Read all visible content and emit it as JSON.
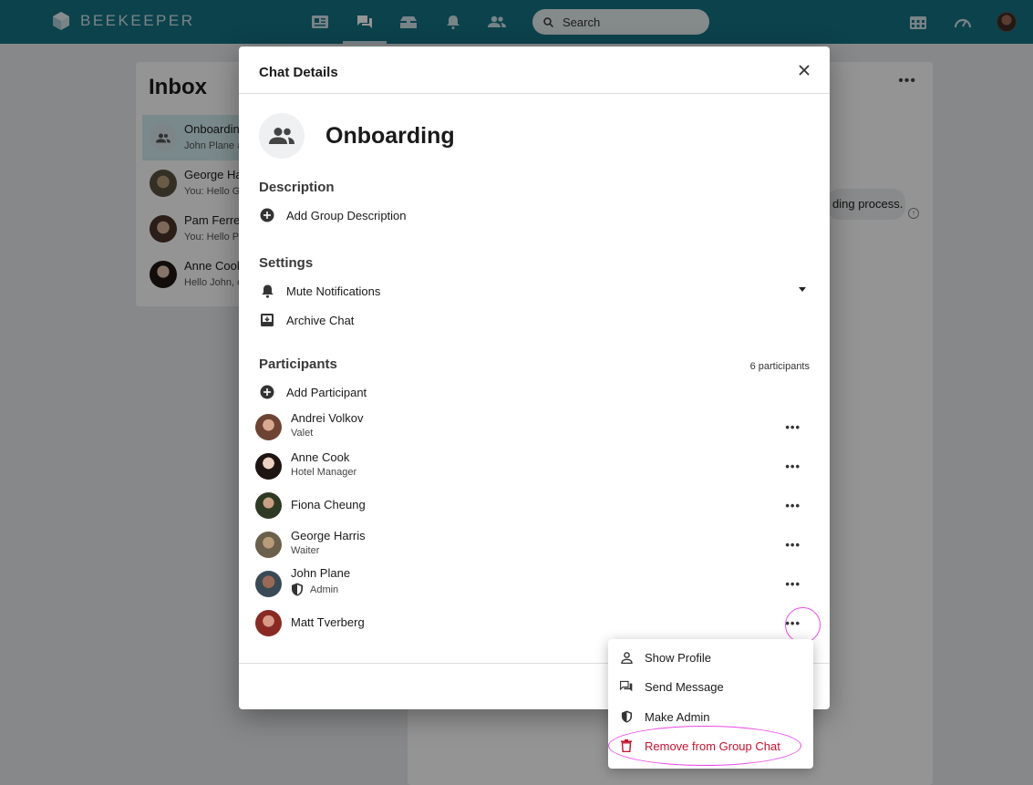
{
  "app": {
    "name": "BEEKEEPER"
  },
  "topbar": {
    "search_placeholder": "Search",
    "nav_icons": [
      "news-icon",
      "chat-icon",
      "tools-icon",
      "bell-icon",
      "people-icon"
    ],
    "right_icons": [
      "shift-icon",
      "dashboard-icon"
    ]
  },
  "inbox": {
    "title": "Inbox",
    "items": [
      {
        "name": "Onboarding",
        "preview": "John Plane added",
        "selected": true
      },
      {
        "name": "George Harris",
        "preview": "You: Hello George"
      },
      {
        "name": "Pam Ferrer",
        "preview": "You: Hello Pam"
      },
      {
        "name": "Anne Cook",
        "preview": "Hello John, ok"
      }
    ]
  },
  "chat": {
    "bubble_text": "ding process."
  },
  "dialog": {
    "title": "Chat Details",
    "group_name": "Onboarding",
    "description": {
      "title": "Description",
      "add_label": "Add Group Description"
    },
    "settings": {
      "title": "Settings",
      "mute_label": "Mute Notifications",
      "archive_label": "Archive Chat"
    },
    "participants": {
      "title": "Participants",
      "count_label": "6 participants",
      "add_label": "Add Participant",
      "list": [
        {
          "name": "Andrei Volkov",
          "role": "Valet"
        },
        {
          "name": "Anne Cook",
          "role": "Hotel Manager"
        },
        {
          "name": "Fiona Cheung",
          "role": ""
        },
        {
          "name": "George Harris",
          "role": "Waiter"
        },
        {
          "name": "John Plane",
          "role": "Admin"
        },
        {
          "name": "Matt Tverberg",
          "role": ""
        }
      ]
    }
  },
  "context_menu": {
    "items": [
      {
        "label": "Show Profile",
        "icon": "person-icon"
      },
      {
        "label": "Send Message",
        "icon": "message-icon"
      },
      {
        "label": "Make Admin",
        "icon": "shield-icon"
      },
      {
        "label": "Remove from Group Chat",
        "icon": "trash-icon"
      }
    ],
    "danger_color": "#c8102e"
  },
  "colors": {
    "topbar": "#167384",
    "highlight": "#e84be8"
  }
}
